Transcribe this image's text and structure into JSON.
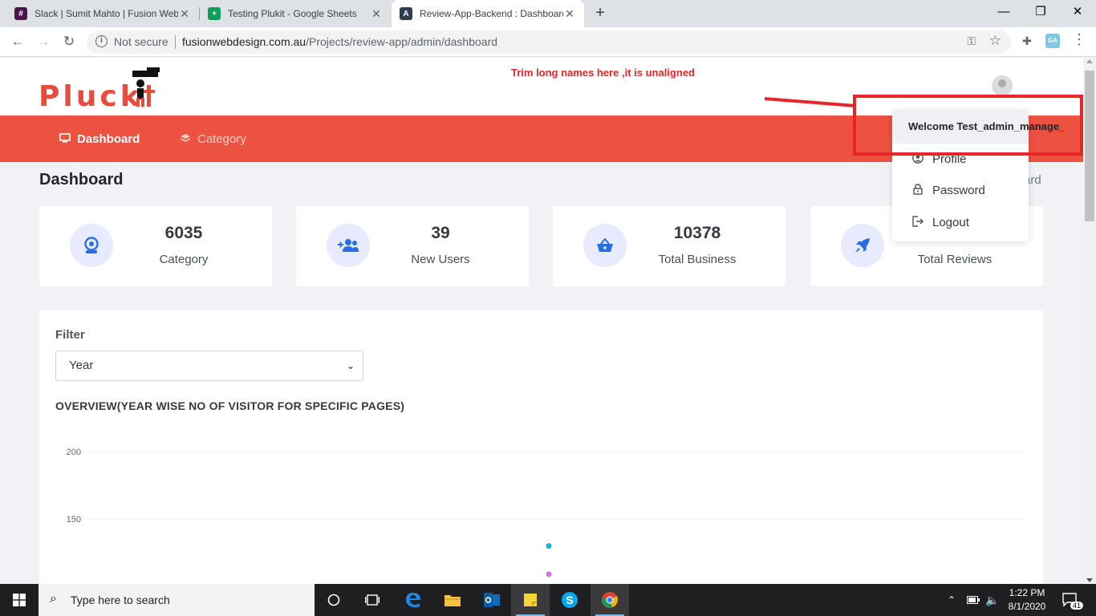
{
  "browser": {
    "tabs": [
      {
        "title": "Slack | Sumit Mahto | Fusion Web",
        "favicon": "slack-icon",
        "color": "#4a154b"
      },
      {
        "title": "Testing Plukit - Google Sheets",
        "favicon": "sheets-icon",
        "color": "#0f9d58"
      },
      {
        "title": "Review-App-Backend : Dashboard",
        "favicon": "app-icon",
        "color": "#2d3e50"
      }
    ],
    "security_label": "Not secure",
    "url_host": "fusionwebdesign.com.au",
    "url_path": "/Projects/review-app/admin/dashboard",
    "ext_ga_label": "GA"
  },
  "header": {
    "logo_text": "Pluck",
    "annotation": "Trim long names here ,it is unaligned"
  },
  "nav": {
    "items": [
      {
        "label": "Dashboard",
        "icon": "monitor-icon"
      },
      {
        "label": "Category",
        "icon": "layers-icon"
      }
    ]
  },
  "page": {
    "title": "Dashboard",
    "breadcrumb_tail": "ard"
  },
  "user_menu": {
    "welcome": "Welcome Test_admin_manage_",
    "items": [
      {
        "label": "Profile",
        "icon": "user-circle-icon"
      },
      {
        "label": "Password",
        "icon": "lock-icon"
      },
      {
        "label": "Logout",
        "icon": "logout-icon"
      }
    ]
  },
  "stats": [
    {
      "value": "6035",
      "label": "Category",
      "icon": "webcam-icon"
    },
    {
      "value": "39",
      "label": "New Users",
      "icon": "users-icon"
    },
    {
      "value": "10378",
      "label": "Total Business",
      "icon": "basket-icon"
    },
    {
      "value": "",
      "label": "Total Reviews",
      "icon": "rocket-icon"
    }
  ],
  "filter": {
    "label": "Filter",
    "selected": "Year"
  },
  "chart_title": "OVERVIEW(YEAR WISE NO OF VISITOR FOR SPECIFIC PAGES)",
  "chart_data": {
    "type": "scatter",
    "title": "OVERVIEW(YEAR WISE NO OF VISITOR FOR SPECIFIC PAGES)",
    "yticks": [
      200,
      150
    ],
    "ylim": [
      100,
      200
    ],
    "series": [
      {
        "values": [
          130
        ],
        "color": "#17b8d6"
      },
      {
        "values": [
          109
        ],
        "color": "#d675de"
      }
    ],
    "grid": true
  },
  "taskbar": {
    "search_placeholder": "Type here to search",
    "time": "1:22 PM",
    "date": "8/1/2020",
    "notifications": "41"
  }
}
